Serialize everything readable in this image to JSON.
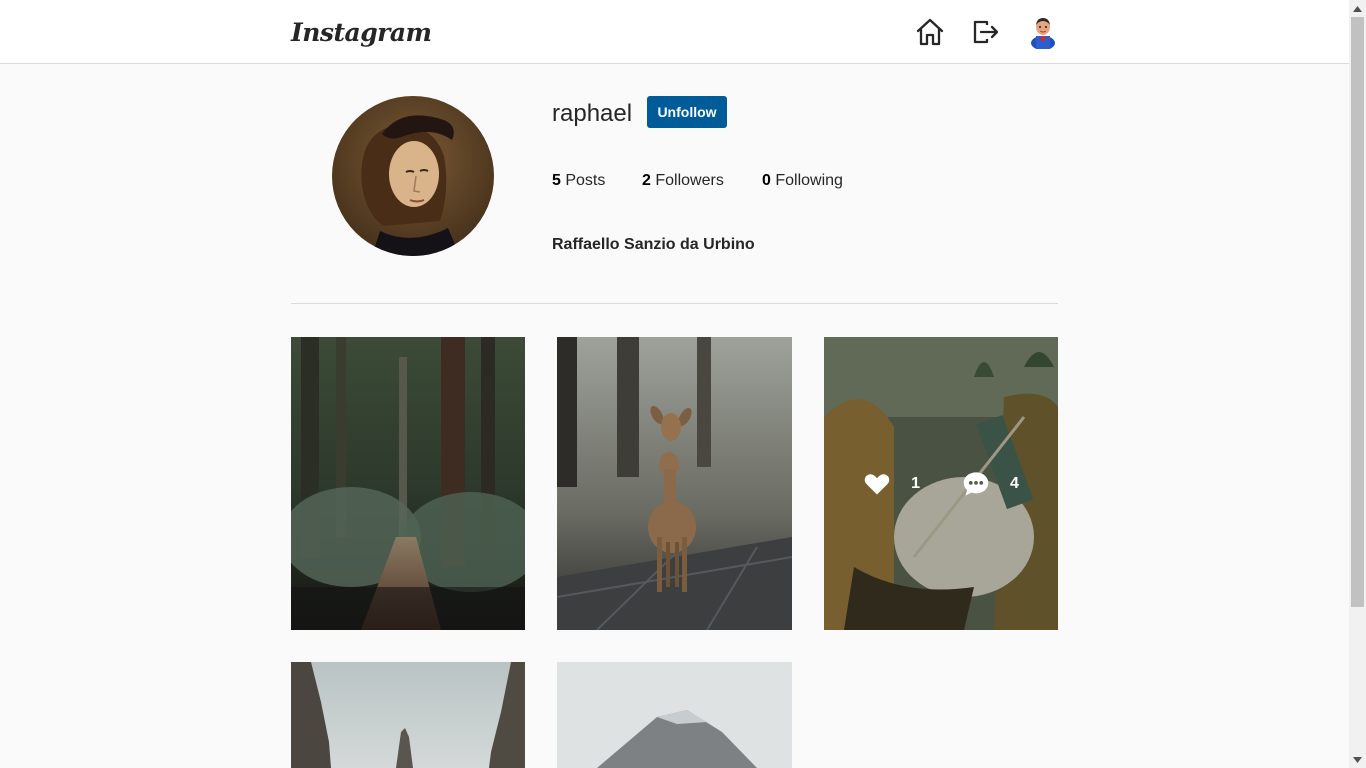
{
  "header": {
    "logo_text": "Instagram",
    "icons": [
      "home-icon",
      "logout-icon",
      "user-avatar"
    ]
  },
  "profile": {
    "username": "raphael",
    "follow_button_label": "Unfollow",
    "stats": {
      "posts_count": "5",
      "posts_label": "Posts",
      "followers_count": "2",
      "followers_label": "Followers",
      "following_count": "0",
      "following_label": "Following"
    },
    "full_name": "Raffaello Sanzio da Urbino"
  },
  "posts": [
    {
      "subject": "forest path"
    },
    {
      "subject": "deer"
    },
    {
      "subject": "painting",
      "likes": "1",
      "comments": "4",
      "hovered": true
    },
    {
      "subject": "rock spires"
    },
    {
      "subject": "mountain"
    }
  ],
  "colors": {
    "accent_button": "#005c98",
    "background": "#fafafa",
    "border": "#dbdbdb"
  }
}
